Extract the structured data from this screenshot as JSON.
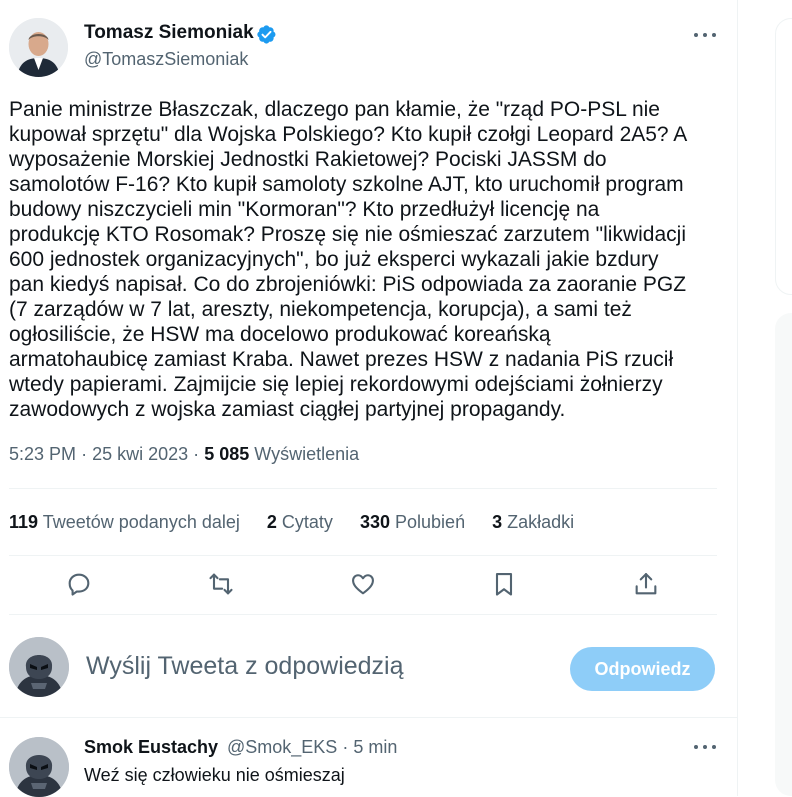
{
  "tweet": {
    "author_name": "Tomasz Siemoniak",
    "author_handle": "@TomaszSiemoniak",
    "text": "Panie ministrze Błaszczak, dlaczego pan kłamie, że \"rząd PO-PSL nie\nkupował sprzętu\" dla Wojska Polskiego? Kto kupił czołgi Leopard 2A5? A\nwyposażenie Morskiej Jednostki Rakietowej? Pociski JASSM do\nsamolotów F-16? Kto kupił samoloty szkolne AJT, kto uruchomił program\nbudowy niszczycieli min \"Kormoran\"? Kto przedłużył licencję na\nprodukcję KTO Rosomak? Proszę się nie ośmieszać zarzutem \"likwidacji\n600 jednostek organizacyjnych\", bo już eksperci wykazali jakie bzdury\npan kiedyś napisał. Co do zbrojeniówki: PiS odpowiada za zaoranie PGZ\n(7 zarządów w 7 lat, areszty, niekompetencja, korupcja), a sami też\nogłosiliście, że HSW ma docelowo produkować koreańską\narmatohaubicę zamiast Kraba. Nawet prezes HSW z nadania PiS rzucił\nwtedy papierami. Zajmijcie się lepiej rekordowymi odejściami żołnierzy\nzawodowych z wojska zamiast ciągłej partyjnej propagandy.",
    "time": "5:23 PM",
    "sep": "·",
    "date": "25 kwi 2023",
    "views_count": "5 085",
    "views_label": "Wyświetlenia"
  },
  "stats": [
    {
      "count": "119",
      "label": "Tweetów podanych dalej"
    },
    {
      "count": "2",
      "label": "Cytaty"
    },
    {
      "count": "330",
      "label": "Polubień"
    },
    {
      "count": "3",
      "label": "Zakładki"
    }
  ],
  "actions": {
    "icons": [
      "reply-icon",
      "retweet-icon",
      "like-icon",
      "bookmark-icon",
      "share-icon"
    ]
  },
  "composer": {
    "placeholder": "Wyślij Tweeta z odpowiedzią",
    "button_label": "Odpowiedz"
  },
  "reply": {
    "author_name": "Smok Eustachy",
    "author_handle": "@Smok_EKS",
    "sep": "·",
    "time": "5 min",
    "text": "Weź się człowieku nie ośmieszaj"
  },
  "colors": {
    "accent": "#1d9bf0",
    "accent_disabled": "#8ecdf8",
    "text_primary": "#0f1419",
    "text_secondary": "#536471",
    "divider": "#eff3f4"
  }
}
